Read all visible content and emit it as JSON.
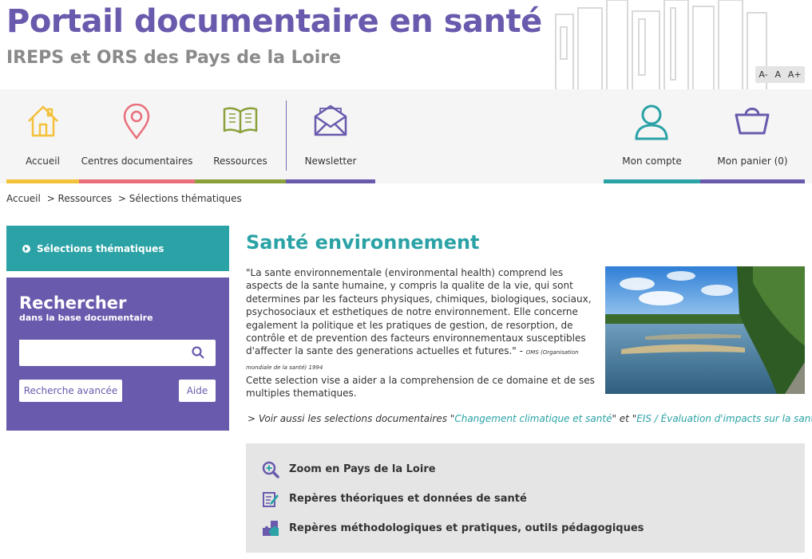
{
  "header": {
    "title": "Portail documentaire en santé",
    "subtitle": "IREPS et ORS des Pays de la Loire",
    "font_controls": [
      "A-",
      "A",
      "A+"
    ]
  },
  "nav": {
    "items": [
      {
        "label": "Accueil",
        "icon": "home-icon",
        "color": "#f3c13a"
      },
      {
        "label": "Centres documentaires",
        "icon": "map-pin-icon",
        "color": "#e96f7b"
      },
      {
        "label": "Ressources",
        "icon": "book-icon",
        "color": "#8aa03a"
      },
      {
        "label": "Newsletter",
        "icon": "envelope-icon",
        "color": "#6a5aad"
      },
      {
        "label": "Mon compte",
        "icon": "user-icon",
        "color": "#2aa2a6"
      },
      {
        "label": "Mon panier (0)",
        "icon": "basket-icon",
        "color": "#6a5aad"
      }
    ]
  },
  "breadcrumb": [
    "Accueil",
    "> Ressources",
    "> Sélections thématiques"
  ],
  "sidebar": {
    "theme_label": "Sélections thématiques",
    "search_title": "Rechercher",
    "search_sub": "dans la base documentaire",
    "search_placeholder": "",
    "advanced_label": "Recherche avancée",
    "help_label": "Aide"
  },
  "main": {
    "title": "Santé environnement",
    "intro": "\"La sante environnementale (environmental health) comprend les aspects de la sante humaine, y compris la qualite de la vie, qui sont determines par les facteurs physiques, chimiques, biologiques, sociaux, psychosociaux et esthetiques de notre environnement. Elle concerne egalement la politique et les pratiques de gestion, de resorption, de contrôle et de prevention des facteurs environnementaux susceptibles d'affecter la sante des generations actuelles et futures.\" - ",
    "intro_source": "OMS (Organisation mondiale de la santé) 1994",
    "intro2": "Cette selection vise a aider a la comprehension de ce domaine et de ses multiples thematiques.",
    "see_also_prefix": "> Voir aussi les selections documentaires \"",
    "see_also_link1": "Changement climatique et santé",
    "see_also_mid": "\" et \"",
    "see_also_link2": "EIS / Évaluation d'impacts sur la santé",
    "see_also_suffix": "\"",
    "topics": [
      {
        "label": "Zoom en Pays de la Loire",
        "icon": "zoom-in-icon"
      },
      {
        "label": "Repères théoriques et données de santé",
        "icon": "notepad-pencil-icon"
      },
      {
        "label": "Repères méthodologiques et pratiques, outils pédagogiques",
        "icon": "puzzle-icon"
      }
    ]
  },
  "colors": {
    "purple": "#6a5aad",
    "teal": "#2aa2a6",
    "yellow": "#f3c13a",
    "pink": "#e96f7b",
    "olive": "#8aa03a"
  }
}
